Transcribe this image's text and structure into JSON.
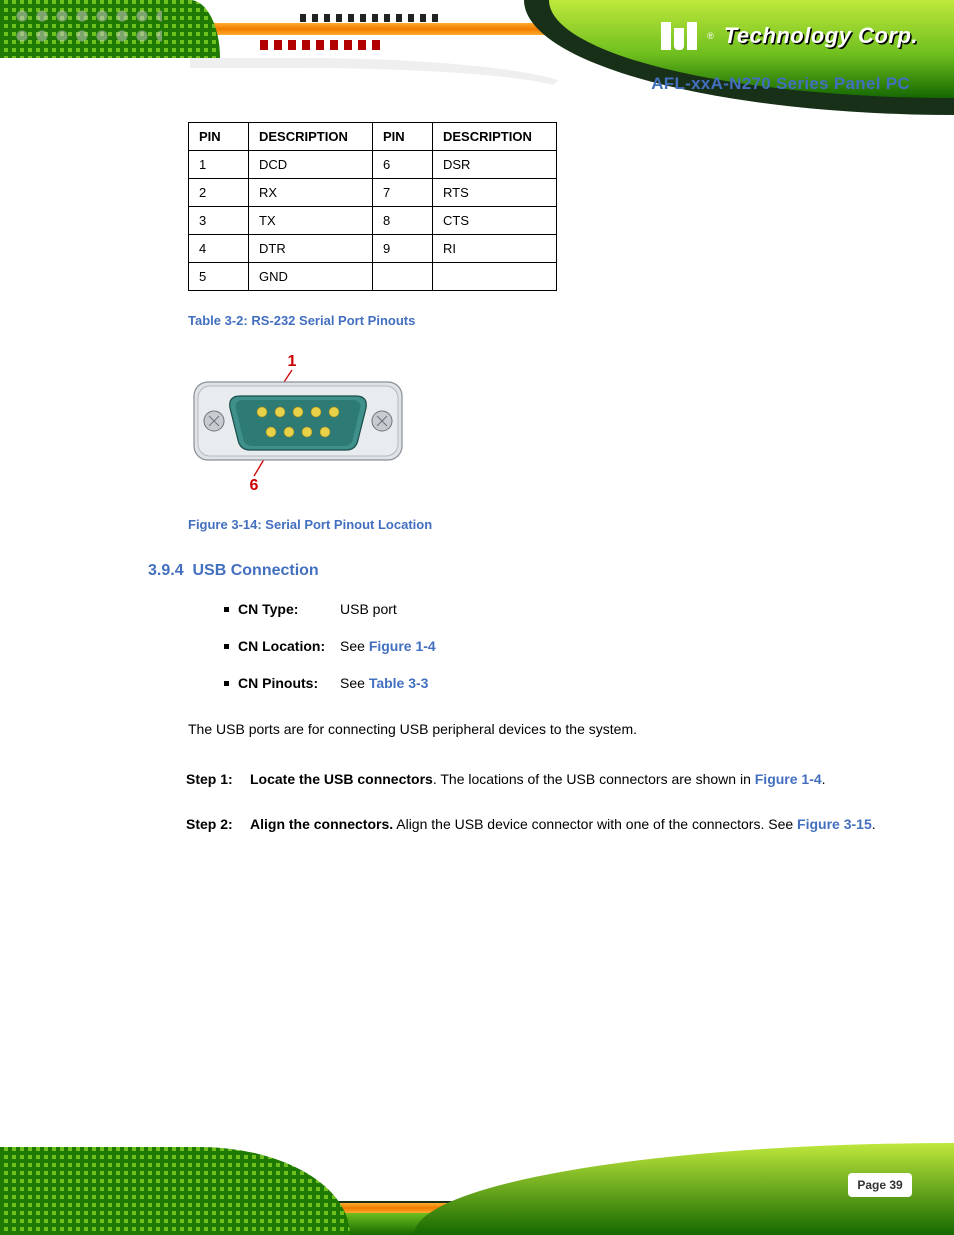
{
  "header": {
    "brand_registered": "®",
    "brand_text": "Technology Corp.",
    "product_name": "AFL-xxA-N270 Series Panel PC"
  },
  "pin_table": {
    "headers": {
      "pin_a": "PIN",
      "desc_a": "DESCRIPTION",
      "pin_b": "PIN",
      "desc_b": "DESCRIPTION"
    },
    "rows": [
      {
        "pin_a": "1",
        "desc_a": "DCD",
        "pin_b": "6",
        "desc_b": "DSR"
      },
      {
        "pin_a": "2",
        "desc_a": "RX",
        "pin_b": "7",
        "desc_b": "RTS"
      },
      {
        "pin_a": "3",
        "desc_a": "TX",
        "pin_b": "8",
        "desc_b": "CTS"
      },
      {
        "pin_a": "4",
        "desc_a": "DTR",
        "pin_b": "9",
        "desc_b": "RI"
      },
      {
        "pin_a": "5",
        "desc_a": "GND",
        "pin_b": "",
        "desc_b": ""
      }
    ],
    "caption": "Table 3-2: RS-232 Serial Port Pinouts"
  },
  "figure14": {
    "pin_top_label": "1",
    "pin_bottom_label": "6",
    "caption": "Figure 3-14: Serial Port Pinout Location"
  },
  "section": {
    "number": "3.9.4",
    "title": "USB Connection"
  },
  "kv": {
    "cn_type_label": "CN Type:",
    "cn_type_value": "USB port",
    "cn_location_label": "CN Location:",
    "cn_location_prefix": "See ",
    "cn_location_link": "Figure 1-4",
    "cn_pinouts_label": "CN Pinouts:",
    "cn_pinouts_prefix": "See ",
    "cn_pinouts_link": "Table 3-3"
  },
  "body": {
    "intro": "The USB ports are for connecting USB peripheral devices to the system."
  },
  "steps": {
    "s1": {
      "lead": "Locate the USB connectors",
      "tail_before_link": ". The locations of the USB connectors are shown in ",
      "link": "Figure 1-4",
      "tail_after_link": "."
    },
    "s2": {
      "lead": "Align the connectors.",
      "mid": " Align the USB device connector with one of the connectors. See ",
      "link": "Figure 3-15",
      "tail": "."
    }
  },
  "footer": {
    "page_label": "Page 39"
  }
}
